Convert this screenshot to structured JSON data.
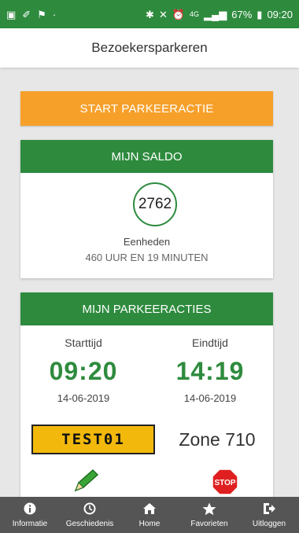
{
  "statusbar": {
    "signal": "4G",
    "battery": "67%",
    "time": "09:20"
  },
  "header": {
    "title": "Bezoekersparkeren"
  },
  "start_button": {
    "label": "START PARKEERACTIE"
  },
  "saldo": {
    "title": "MIJN SALDO",
    "units_value": "2762",
    "units_label": "Eenheden",
    "time_remaining": "460 UUR EN 19 MINUTEN"
  },
  "parkeeracties": {
    "title": "MIJN PARKEERACTIES",
    "start_label": "Starttijd",
    "start_time": "09:20",
    "start_date": "14-06-2019",
    "end_label": "Eindtijd",
    "end_time": "14:19",
    "end_date": "14-06-2019",
    "license_plate": "TEST01",
    "zone": "Zone 710",
    "stop_label": "STOP"
  },
  "tabs": [
    {
      "label": "Informatie",
      "icon": "info-icon"
    },
    {
      "label": "Geschiedenis",
      "icon": "clock-icon"
    },
    {
      "label": "Home",
      "icon": "home-icon"
    },
    {
      "label": "Favorieten",
      "icon": "star-icon"
    },
    {
      "label": "Uitloggen",
      "icon": "logout-icon"
    }
  ],
  "colors": {
    "green": "#2e8b3e",
    "orange": "#f6a02a",
    "plate_yellow": "#f2b90c",
    "stop_red": "#e02020",
    "tabbar": "#555555"
  }
}
